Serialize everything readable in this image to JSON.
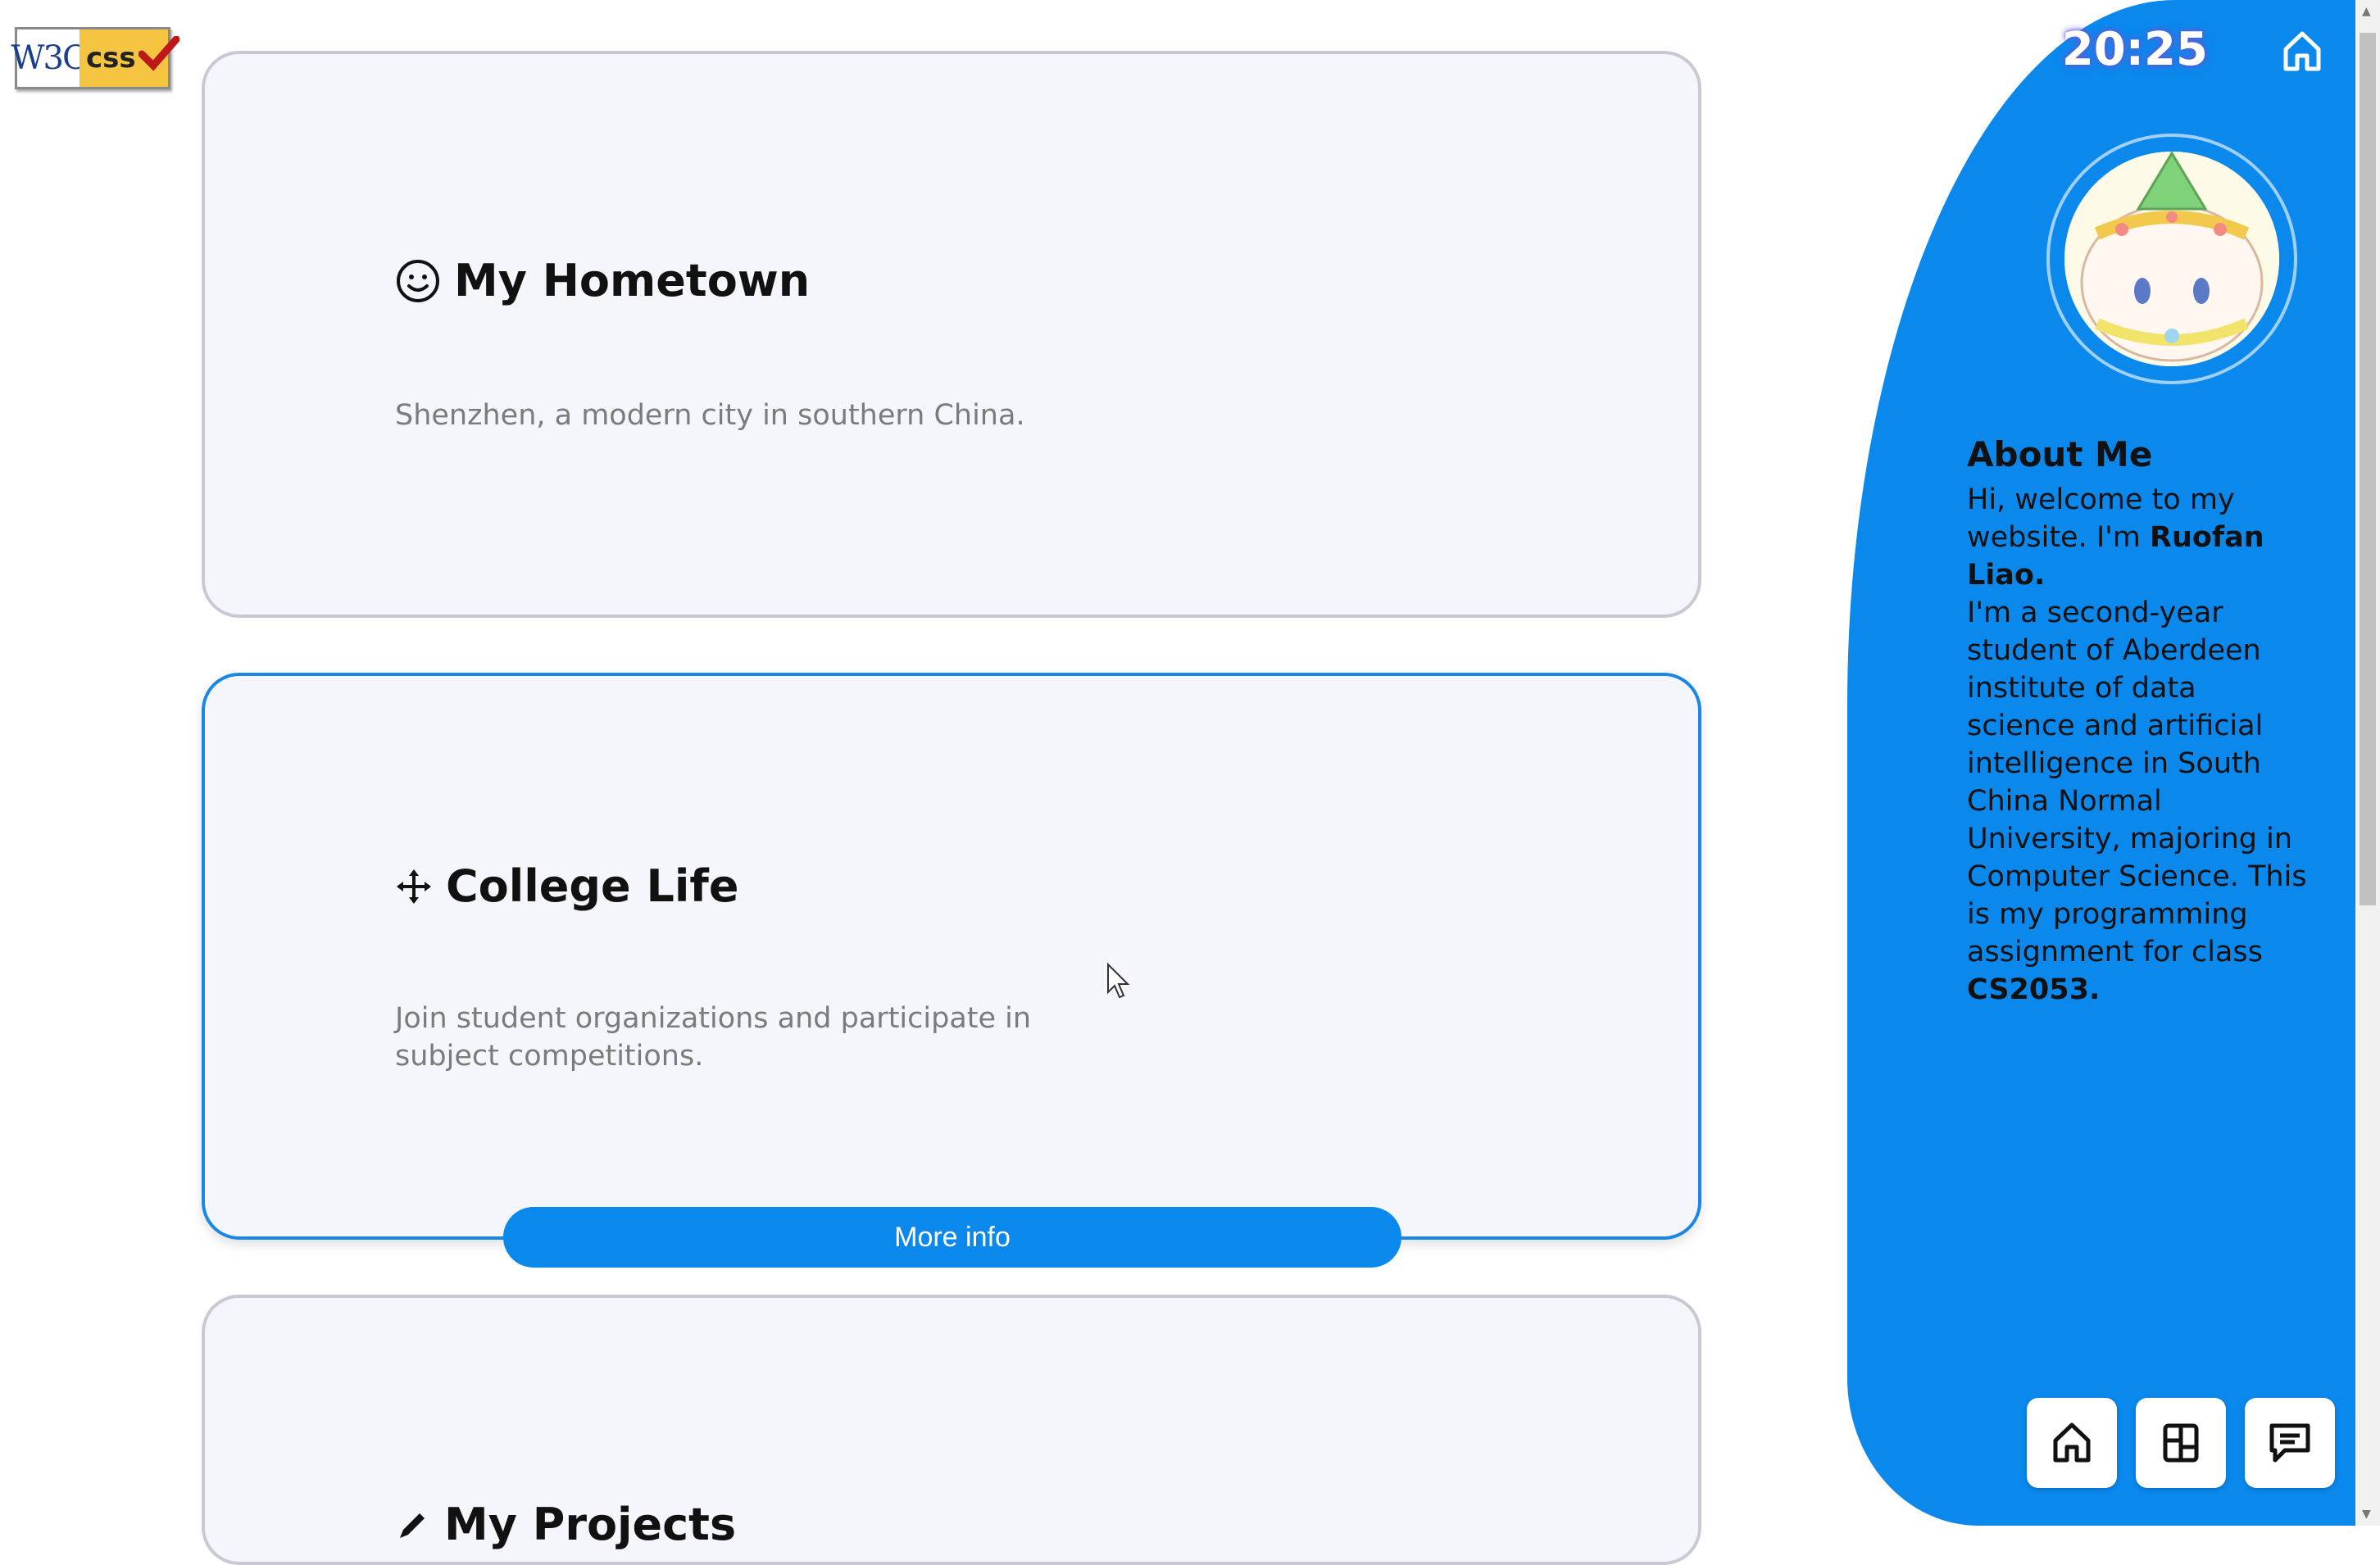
{
  "badge": {
    "w3c": "W3C",
    "css": "css"
  },
  "cards": [
    {
      "title": "My Hometown",
      "icon": "smiley-icon",
      "text": "Shenzhen, a modern city in southern China."
    },
    {
      "title": "College Life",
      "icon": "move-cross-icon",
      "text": "Join student organizations and participate in subject competitions.",
      "button": "More info"
    },
    {
      "title": "My Projects",
      "icon": "pen-icon"
    }
  ],
  "sidebar": {
    "time": "20:25",
    "about_title": "About Me",
    "about_intro": "Hi, welcome to my website. I'm ",
    "name": "Ruofan Liao.",
    "about_body": "I'm a second-year student of Aberdeen institute of data science and artificial intelligence in South China Normal University, majoring in Computer Science. This is my programming assignment for class ",
    "course": "CS2053.",
    "nav": [
      "home-icon",
      "layout-icon",
      "message-icon"
    ]
  },
  "colors": {
    "accent": "#0a88ec",
    "card_bg": "#f5f6fb",
    "card_border": "#c8c9d4"
  }
}
